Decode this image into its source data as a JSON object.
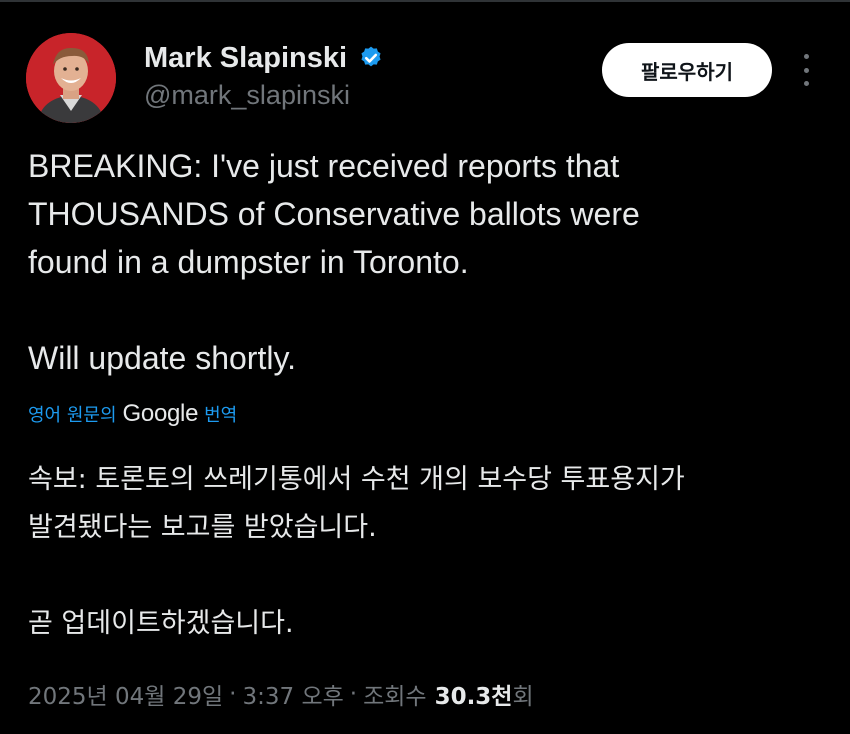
{
  "author": {
    "name": "Mark Slapinski",
    "handle": "@mark_slapinski",
    "verified_icon": "verified-badge-icon",
    "verified_color": "#1d9bf0"
  },
  "header": {
    "follow_label": "팔로우하기",
    "more_icon": "more-dots-icon"
  },
  "tweet": {
    "lines": [
      "BREAKING: I've just received reports that",
      "THOUSANDS of Conservative ballots were",
      "found in a dumpster in Toronto.",
      "Will update shortly."
    ]
  },
  "translation": {
    "label": "영어 원문의",
    "provider": "Google",
    "action": "번역",
    "lines": [
      "속보: 토론토의 쓰레기통에서 수천 개의 보수당 투표용지가",
      "발견됐다는 보고를 받았습니다.",
      "곧 업데이트하겠습니다."
    ]
  },
  "meta": {
    "date": "2025년 04월 29일",
    "separator": "·",
    "time": "3:37 오후",
    "views_label": "조회수",
    "views_value": "30.3천",
    "views_suffix": "회"
  },
  "colors": {
    "background": "#000000",
    "text": "#e7e9ea",
    "secondary": "#71767b",
    "link": "#1d9bf0"
  }
}
